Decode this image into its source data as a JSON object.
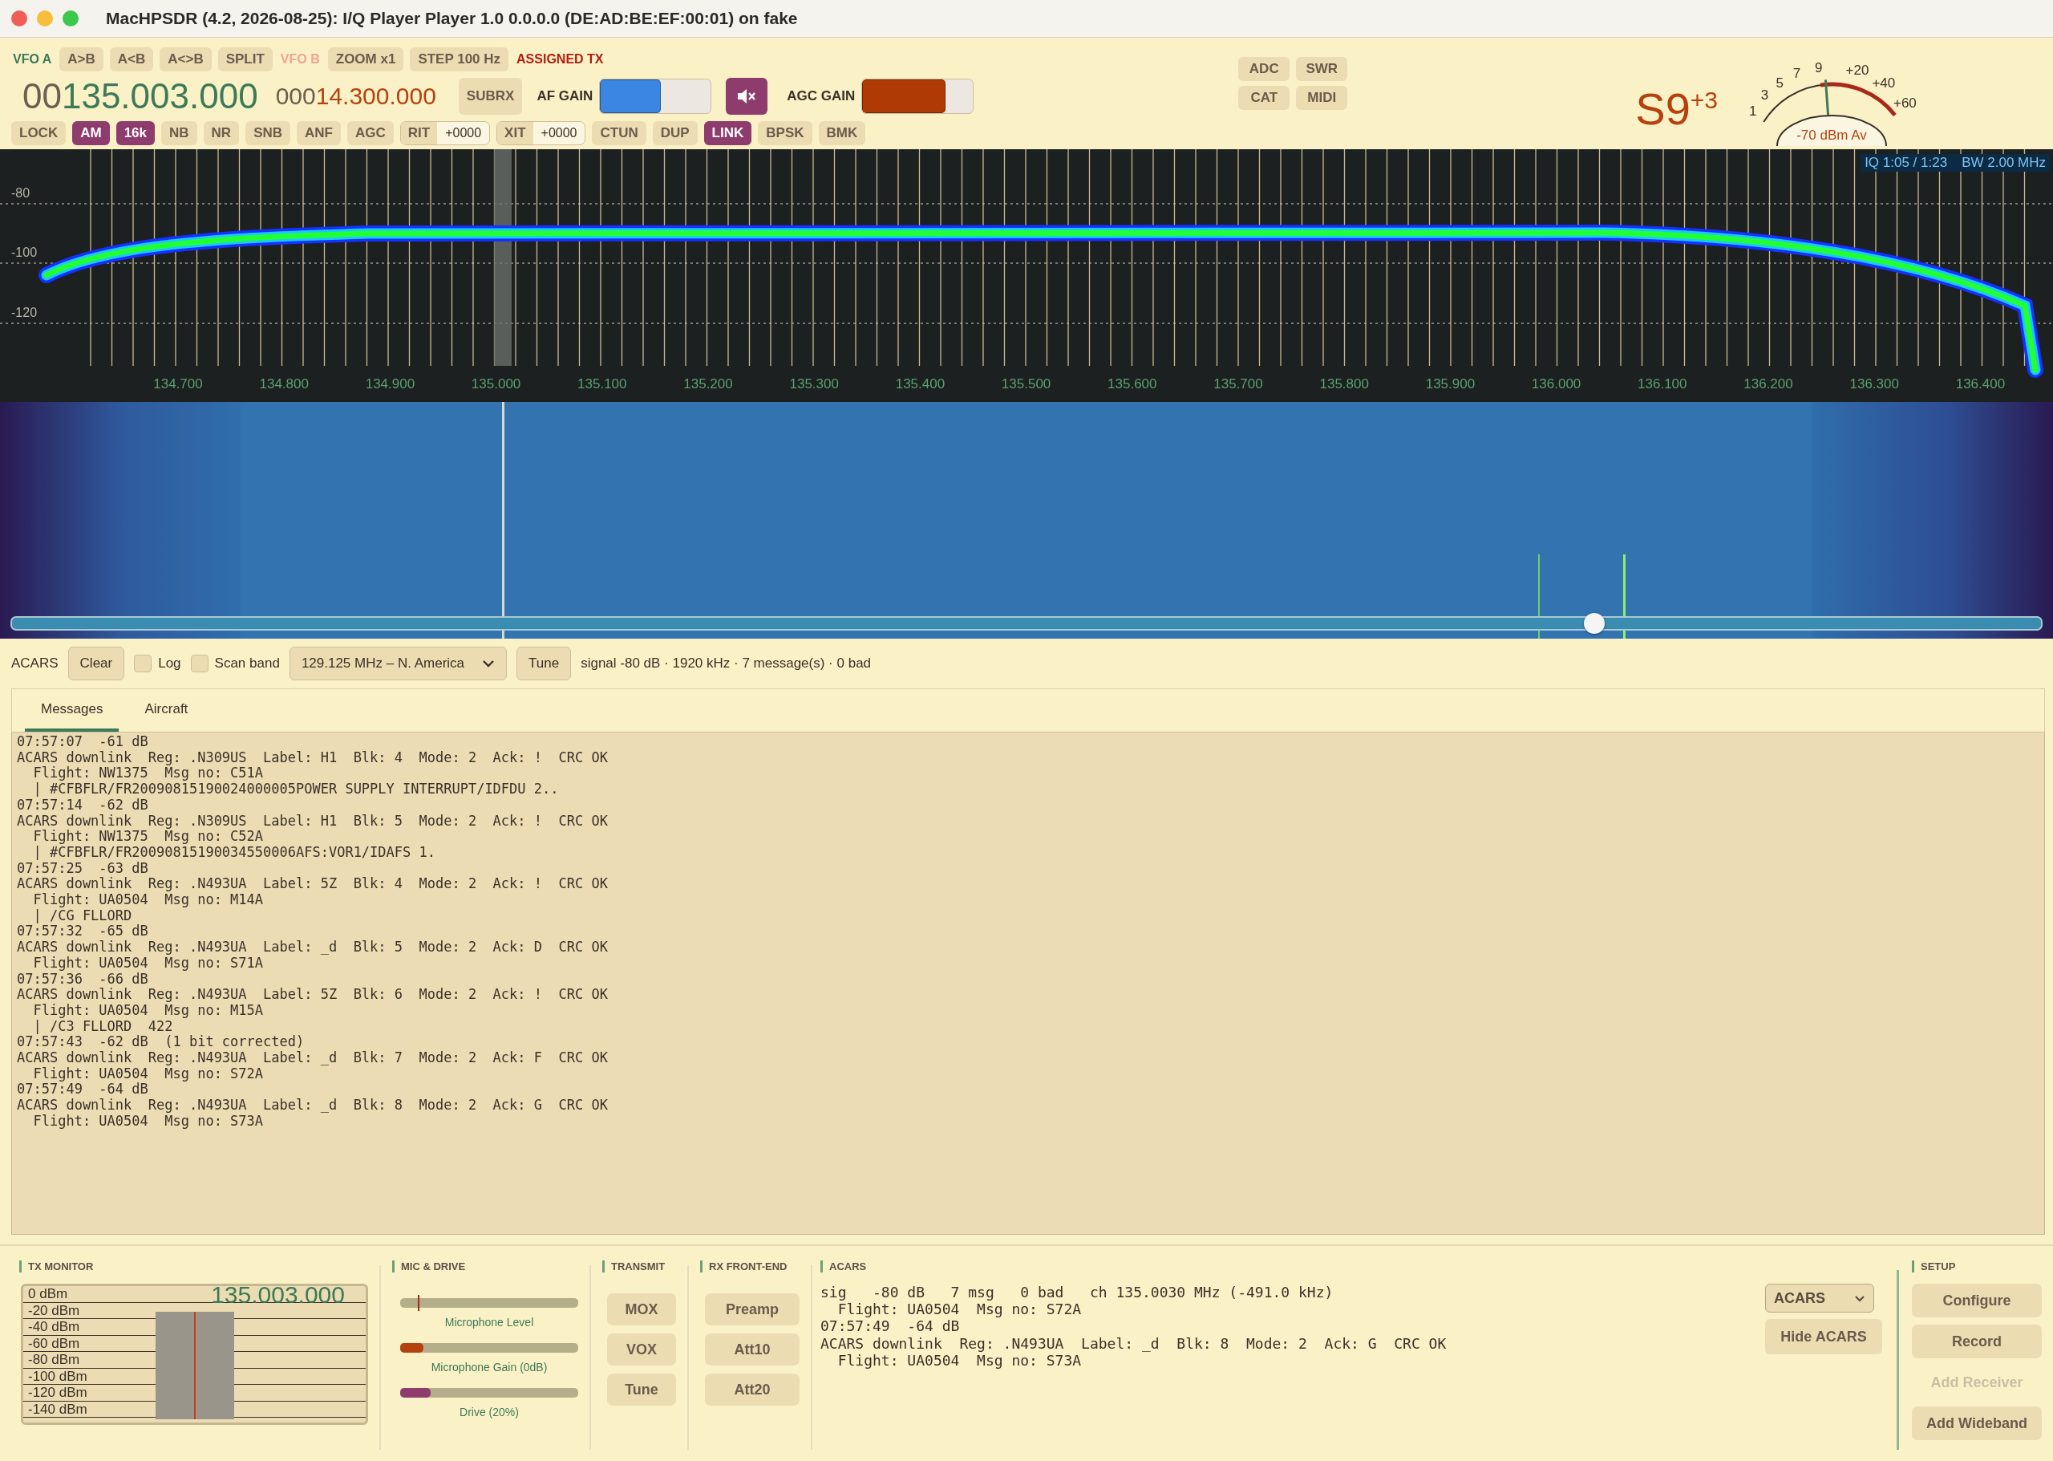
{
  "window": {
    "title": "MacHPSDR (4.2, 2026-08-25): I/Q Player Player 1.0 0.0.0.0 (DE:AD:BE:EF:00:01) on fake"
  },
  "vfo_row": [
    {
      "kind": "tag",
      "text": "VFO A",
      "color": "#3d7a57"
    },
    {
      "kind": "button",
      "text": "A>B"
    },
    {
      "kind": "button",
      "text": "A<B"
    },
    {
      "kind": "button",
      "text": "A<>B"
    },
    {
      "kind": "button",
      "text": "SPLIT"
    },
    {
      "kind": "tag",
      "text": "VFO B",
      "color": "#f0a58c"
    },
    {
      "kind": "button",
      "text": "ZOOM x1"
    },
    {
      "kind": "button",
      "text": "STEP 100 Hz"
    },
    {
      "kind": "tag",
      "text": "ASSIGNED TX",
      "color": "#b01e12"
    }
  ],
  "freq_a": {
    "prefix": "00",
    "value": "135.003.000"
  },
  "freq_b": {
    "prefix": "000",
    "value": "14.300.000"
  },
  "subrx": "SUBRX",
  "af_gain": {
    "label": "AF GAIN",
    "level": 0.55
  },
  "mute": {
    "on": true
  },
  "agc_gain": {
    "label": "AGC GAIN",
    "level": 0.75
  },
  "mode_row": [
    {
      "kind": "toggle",
      "text": "LOCK",
      "on": false
    },
    {
      "kind": "toggle",
      "text": "AM",
      "on": true
    },
    {
      "kind": "toggle",
      "text": "16k",
      "on": true
    },
    {
      "kind": "toggle",
      "text": "NB",
      "on": false
    },
    {
      "kind": "toggle",
      "text": "NR",
      "on": false
    },
    {
      "kind": "toggle",
      "text": "SNB",
      "on": false
    },
    {
      "kind": "toggle",
      "text": "ANF",
      "on": false
    },
    {
      "kind": "toggle",
      "text": "AGC",
      "on": false
    },
    {
      "kind": "field",
      "text": "RIT",
      "value": "+0000"
    },
    {
      "kind": "field",
      "text": "XIT",
      "value": "+0000"
    },
    {
      "kind": "toggle",
      "text": "CTUN",
      "on": false
    },
    {
      "kind": "toggle",
      "text": "DUP",
      "on": false
    },
    {
      "kind": "toggle",
      "text": "LINK",
      "on": true
    },
    {
      "kind": "toggle",
      "text": "BPSK",
      "on": false
    },
    {
      "kind": "toggle",
      "text": "BMK",
      "on": false
    }
  ],
  "aux_buttons": [
    "ADC",
    "SWR",
    "CAT",
    "MIDI"
  ],
  "s_meter": {
    "reading": "S9$^{+3}$",
    "scale": [
      "1",
      "3",
      "5",
      "7",
      "9",
      "+20",
      "+40",
      "+60"
    ],
    "average": "-70 dBm Av",
    "level": 0.49
  },
  "spectrum": {
    "iq": "IQ 1:05 / 1:23",
    "bw": "BW 2.00 MHz",
    "db_labels": [
      "-80",
      "-100",
      "-120"
    ],
    "freq_labels": [
      "134.700",
      "134.800",
      "134.900",
      "135.000",
      "135.100",
      "135.200",
      "135.300",
      "135.400",
      "135.500",
      "135.600",
      "135.700",
      "135.800",
      "135.900",
      "136.000",
      "136.100",
      "136.200",
      "136.300",
      "136.400"
    ]
  },
  "waterfall": {
    "slider": {
      "level": 0.78
    }
  },
  "acars_bar": {
    "label": "ACARS",
    "clear": "Clear",
    "log": {
      "label": "Log",
      "checked": false
    },
    "scan": {
      "label": "Scan band",
      "checked": false
    },
    "channel": "129.125 MHz – N. America",
    "tune": "Tune",
    "status": "signal -80 dB · 1920 kHz · 7 message(s) · 0 bad"
  },
  "tabs": [
    {
      "label": "Messages",
      "selected": true
    },
    {
      "label": "Aircraft",
      "selected": false
    }
  ],
  "log_lines": [
    "07:57:07  -61 dB",
    "ACARS downlink  Reg: .N309US  Label: H1  Blk: 4  Mode: 2  Ack: !  CRC OK",
    "  Flight: NW1375  Msg no: C51A",
    "  | #CFBFLR/FR20090815190024000005POWER SUPPLY INTERRUPT/IDFDU 2..",
    "07:57:14  -62 dB",
    "ACARS downlink  Reg: .N309US  Label: H1  Blk: 5  Mode: 2  Ack: !  CRC OK",
    "  Flight: NW1375  Msg no: C52A",
    "  | #CFBFLR/FR20090815190034550006AFS:VOR1/IDAFS 1.",
    "07:57:25  -63 dB",
    "ACARS downlink  Reg: .N493UA  Label: 5Z  Blk: 4  Mode: 2  Ack: !  CRC OK",
    "  Flight: UA0504  Msg no: M14A",
    "  | /CG FLLORD",
    "07:57:32  -65 dB",
    "ACARS downlink  Reg: .N493UA  Label: _d  Blk: 5  Mode: 2  Ack: D  CRC OK",
    "  Flight: UA0504  Msg no: S71A",
    "07:57:36  -66 dB",
    "ACARS downlink  Reg: .N493UA  Label: 5Z  Blk: 6  Mode: 2  Ack: !  CRC OK",
    "  Flight: UA0504  Msg no: M15A",
    "  | /C3 FLLORD  422",
    "07:57:43  -62 dB  (1 bit corrected)",
    "ACARS downlink  Reg: .N493UA  Label: _d  Blk: 7  Mode: 2  Ack: F  CRC OK",
    "  Flight: UA0504  Msg no: S72A",
    "07:57:49  -64 dB",
    "ACARS downlink  Reg: .N493UA  Label: _d  Blk: 8  Mode: 2  Ack: G  CRC OK",
    "  Flight: UA0504  Msg no: S73A"
  ],
  "tx_monitor": {
    "title": "TX MONITOR",
    "frequency": "135.003.000",
    "scale": [
      "0 dBm",
      "-20 dBm",
      "-40 dBm",
      "-60 dBm",
      "-80 dBm",
      "-100 dBm",
      "-120 dBm",
      "-140 dBm"
    ]
  },
  "mic_drive": {
    "title": "MIC & DRIVE",
    "sliders": [
      {
        "kind": "marker",
        "label": "Microphone Level",
        "level": 0.1,
        "color": "#a8281a"
      },
      {
        "kind": "fill",
        "label": "Microphone Gain (0dB)",
        "level": 0.13,
        "color": "#b5420e"
      },
      {
        "kind": "fill",
        "label": "Drive (20%)",
        "level": 0.17,
        "color": "#8e3b6e"
      }
    ]
  },
  "transmit": {
    "title": "TRANSMIT",
    "buttons": [
      "MOX",
      "VOX",
      "Tune"
    ]
  },
  "rx_front_end": {
    "title": "RX FRONT-END",
    "buttons": [
      "Preamp",
      "Att10",
      "Att20"
    ]
  },
  "acars_panel": {
    "title": "ACARS",
    "lines": [
      "sig   -80 dB   7 msg   0 bad   ch 135.0030 MHz (-491.0 kHz)",
      "  Flight: UA0504  Msg no: S72A",
      "07:57:49  -64 dB",
      "ACARS downlink  Reg: .N493UA  Label: _d  Blk: 8  Mode: 2  Ack: G  CRC OK",
      "  Flight: UA0504  Msg no: S73A"
    ],
    "mode": "ACARS",
    "hide": "Hide ACARS"
  },
  "setup": {
    "title": "SETUP",
    "buttons": [
      {
        "label": "Configure",
        "disabled": false
      },
      {
        "label": "Record",
        "disabled": false
      },
      {
        "label": "Add Receiver",
        "disabled": true
      },
      {
        "label": "Add Wideband",
        "disabled": false
      }
    ]
  }
}
